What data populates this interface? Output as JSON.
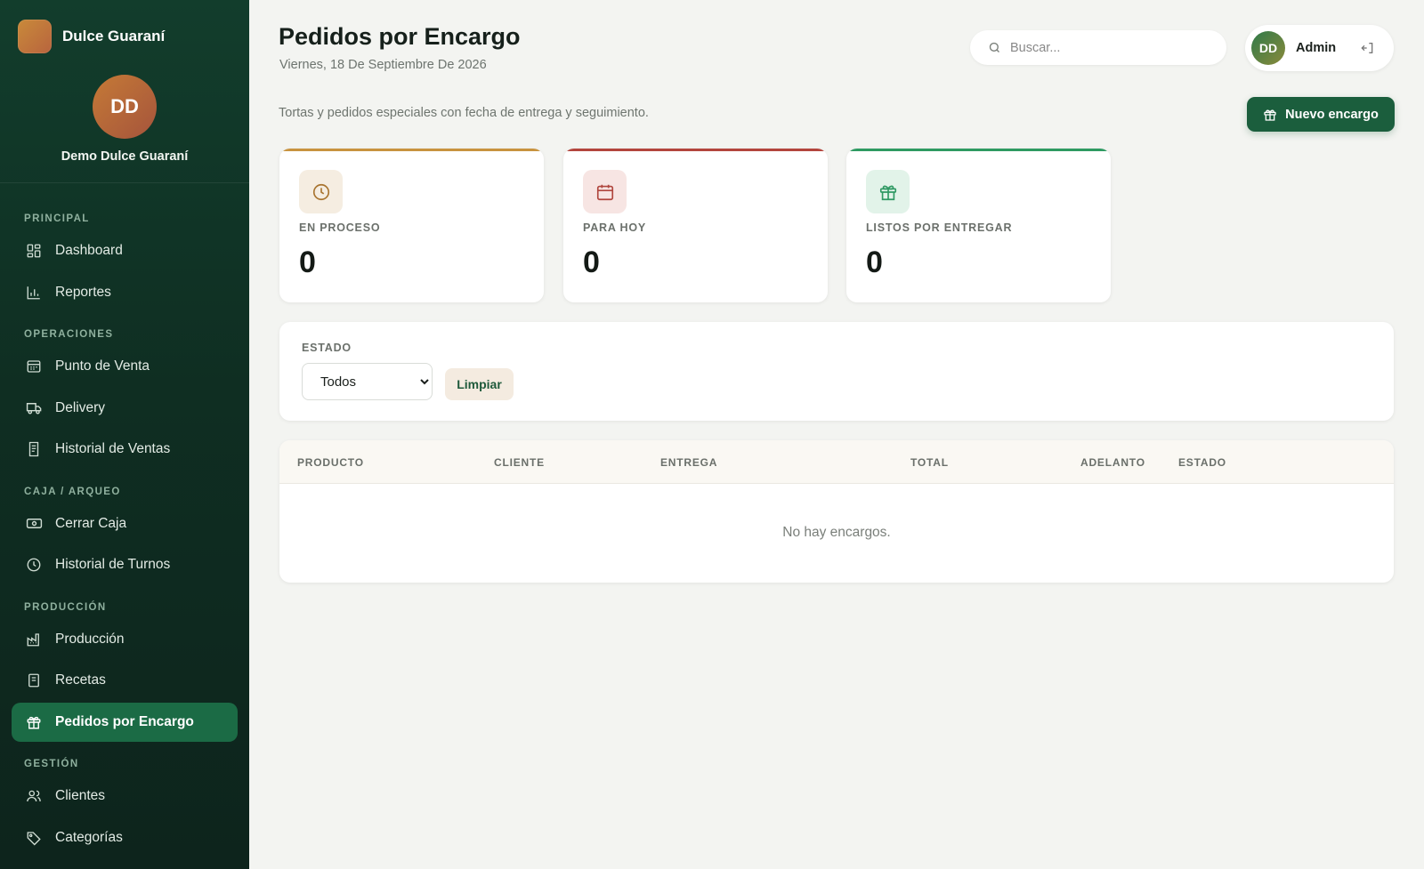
{
  "brand": {
    "name": "Dulce Guaraní"
  },
  "profile": {
    "initials": "DD",
    "name": "Demo Dulce Guaraní"
  },
  "nav": {
    "sections": [
      {
        "title": "PRINCIPAL",
        "items": [
          {
            "label": "Dashboard",
            "icon": "dashboard-icon"
          },
          {
            "label": "Reportes",
            "icon": "bar-chart-icon"
          }
        ]
      },
      {
        "title": "OPERACIONES",
        "items": [
          {
            "label": "Punto de Venta",
            "icon": "register-icon"
          },
          {
            "label": "Delivery",
            "icon": "truck-icon"
          },
          {
            "label": "Historial de Ventas",
            "icon": "receipt-icon"
          }
        ]
      },
      {
        "title": "CAJA / ARQUEO",
        "items": [
          {
            "label": "Cerrar Caja",
            "icon": "cash-icon"
          },
          {
            "label": "Historial de Turnos",
            "icon": "clock-icon"
          }
        ]
      },
      {
        "title": "PRODUCCIÓN",
        "items": [
          {
            "label": "Producción",
            "icon": "factory-icon"
          },
          {
            "label": "Recetas",
            "icon": "recipe-book-icon"
          },
          {
            "label": "Pedidos por Encargo",
            "icon": "gift-icon",
            "active": true
          }
        ]
      },
      {
        "title": "GESTIÓN",
        "items": [
          {
            "label": "Clientes",
            "icon": "users-icon"
          },
          {
            "label": "Categorías",
            "icon": "tag-icon"
          }
        ]
      }
    ]
  },
  "header": {
    "title": "Pedidos por Encargo",
    "date": "Viernes, 18 De Septiembre De 2026",
    "subtitle": "Tortas y pedidos especiales con fecha de entrega y seguimiento."
  },
  "search": {
    "placeholder": "Buscar..."
  },
  "user": {
    "initials": "DD",
    "name": "Admin"
  },
  "actions": {
    "new_order": "Nuevo encargo"
  },
  "stats": [
    {
      "label": "EN PROCESO",
      "value": "0",
      "accent": "#c8933f",
      "icon_bg": "#f5ede1",
      "icon_color": "#a8742f"
    },
    {
      "label": "PARA HOY",
      "value": "0",
      "accent": "#b3453d",
      "icon_bg": "#f7e5e3",
      "icon_color": "#b0463e"
    },
    {
      "label": "LISTOS POR ENTREGAR",
      "value": "0",
      "accent": "#2e9a62",
      "icon_bg": "#e2f3e9",
      "icon_color": "#2f9963"
    }
  ],
  "filter": {
    "label": "ESTADO",
    "selected": "Todos",
    "clear_label": "Limpiar"
  },
  "table": {
    "columns": [
      "PRODUCTO",
      "CLIENTE",
      "ENTREGA",
      "TOTAL",
      "ADELANTO",
      "ESTADO"
    ],
    "empty_message": "No hay encargos."
  }
}
